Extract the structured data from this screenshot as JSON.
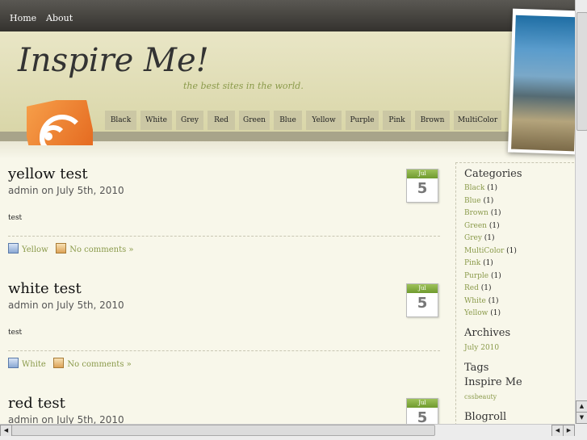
{
  "topnav": {
    "home": "Home",
    "about": "About"
  },
  "site": {
    "title": "Inspire Me!",
    "tagline": "the best sites in the world."
  },
  "color_nav": [
    "Black",
    "White",
    "Grey",
    "Red",
    "Green",
    "Blue",
    "Yellow",
    "Purple",
    "Pink",
    "Brown",
    "MultiColor"
  ],
  "posts": [
    {
      "title": "yellow test",
      "meta": "admin on July 5th, 2010",
      "body": "test",
      "category": "Yellow",
      "comments": "No comments »",
      "cal_month": "Jul",
      "cal_day": "5"
    },
    {
      "title": "white test",
      "meta": "admin on July 5th, 2010",
      "body": "test",
      "category": "White",
      "comments": "No comments »",
      "cal_month": "Jul",
      "cal_day": "5"
    },
    {
      "title": "red test",
      "meta": "admin on July 5th, 2010",
      "body": "",
      "category": "",
      "comments": "",
      "cal_month": "Jul",
      "cal_day": "5"
    }
  ],
  "sidebar": {
    "categories_title": "Categories",
    "categories": [
      {
        "name": "Black",
        "count": "(1)"
      },
      {
        "name": "Blue",
        "count": "(1)"
      },
      {
        "name": "Brown",
        "count": "(1)"
      },
      {
        "name": "Green",
        "count": "(1)"
      },
      {
        "name": "Grey",
        "count": "(1)"
      },
      {
        "name": "MultiColor",
        "count": "(1)"
      },
      {
        "name": "Pink",
        "count": "(1)"
      },
      {
        "name": "Purple",
        "count": "(1)"
      },
      {
        "name": "Red",
        "count": "(1)"
      },
      {
        "name": "White",
        "count": "(1)"
      },
      {
        "name": "Yellow",
        "count": "(1)"
      }
    ],
    "archives_title": "Archives",
    "archives": [
      "July 2010"
    ],
    "tags_title": "Tags",
    "tags_heading": "Inspire Me",
    "tags": [
      "cssbeauty"
    ],
    "blogroll_title": "Blogroll"
  },
  "colors": {
    "accent": "#8a9a4a",
    "topbar": "#3d3b37",
    "calendar_green": "#7fa83c",
    "rss_orange": "#e8742a"
  },
  "icons": {
    "rss": "rss-feed-icon",
    "post_category": "document-icon",
    "post_comments": "package-icon"
  }
}
